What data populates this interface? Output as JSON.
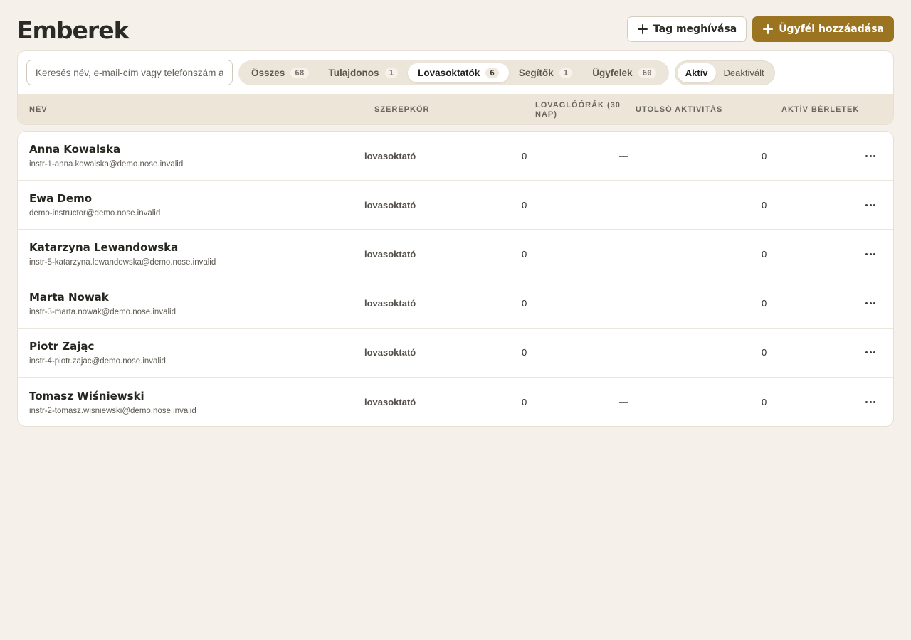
{
  "header": {
    "title": "Emberek",
    "invite_button": "Tag meghívása",
    "add_client_button": "Ügyfél hozzáadása"
  },
  "search": {
    "placeholder": "Keresés név, e-mail-cím vagy telefonszám alapján"
  },
  "filters": {
    "roles": [
      {
        "label": "Összes",
        "count": "68"
      },
      {
        "label": "Tulajdonos",
        "count": "1"
      },
      {
        "label": "Lovasoktatók",
        "count": "6"
      },
      {
        "label": "Segítők",
        "count": "1"
      },
      {
        "label": "Ügyfelek",
        "count": "60"
      }
    ],
    "active_role_index": 2,
    "status": [
      "Aktív",
      "Deaktivált"
    ],
    "active_status_index": 0
  },
  "table": {
    "columns": {
      "name": "Név",
      "role": "Szerepkör",
      "hours": "Lovaglóórák (30 nap)",
      "activity": "Utolsó aktivitás",
      "passes": "Aktív bérletek"
    },
    "rows": [
      {
        "name": "Anna Kowalska",
        "email": "instr-1-anna.kowalska@demo.nose.invalid",
        "role": "lovasoktató",
        "hours": "0",
        "activity": "—",
        "passes": "0"
      },
      {
        "name": "Ewa Demo",
        "email": "demo-instructor@demo.nose.invalid",
        "role": "lovasoktató",
        "hours": "0",
        "activity": "—",
        "passes": "0"
      },
      {
        "name": "Katarzyna Lewandowska",
        "email": "instr-5-katarzyna.lewandowska@demo.nose.invalid",
        "role": "lovasoktató",
        "hours": "0",
        "activity": "—",
        "passes": "0"
      },
      {
        "name": "Marta Nowak",
        "email": "instr-3-marta.nowak@demo.nose.invalid",
        "role": "lovasoktató",
        "hours": "0",
        "activity": "—",
        "passes": "0"
      },
      {
        "name": "Piotr Zając",
        "email": "instr-4-piotr.zajac@demo.nose.invalid",
        "role": "lovasoktató",
        "hours": "0",
        "activity": "—",
        "passes": "0"
      },
      {
        "name": "Tomasz Wiśniewski",
        "email": "instr-2-tomasz.wisniewski@demo.nose.invalid",
        "role": "lovasoktató",
        "hours": "0",
        "activity": "—",
        "passes": "0"
      }
    ]
  },
  "colors": {
    "background": "#f5f1ea",
    "primary": "#9a7420",
    "table_header": "#ede5d8"
  },
  "icons": {
    "plus": "plus-icon",
    "row_menu": "more-icon"
  }
}
